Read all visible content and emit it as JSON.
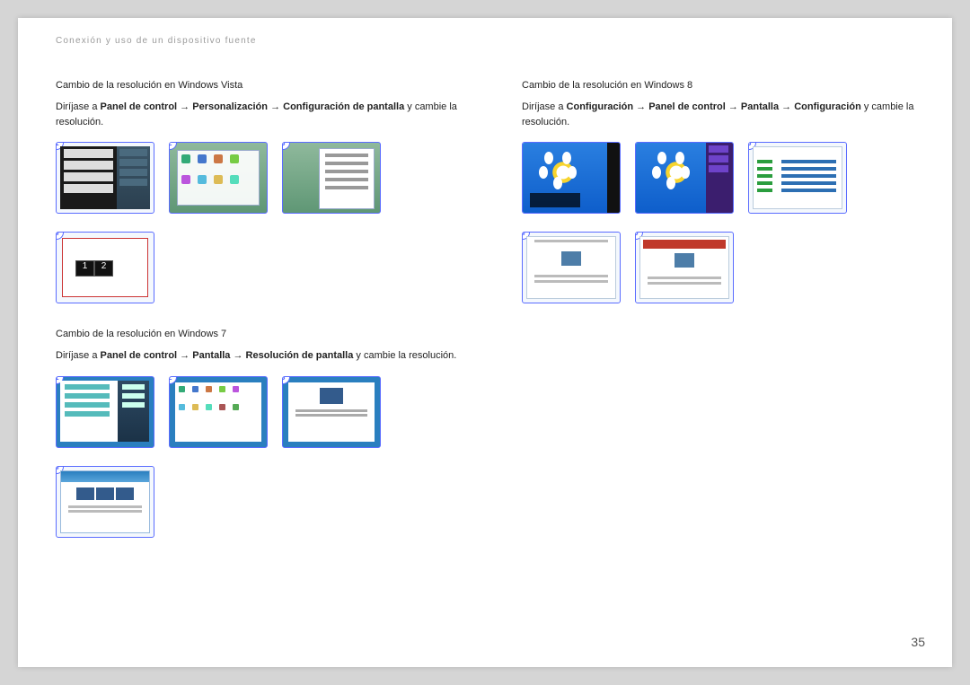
{
  "chapter": "Conexión y uso de un dispositivo fuente",
  "page_number": "35",
  "left": {
    "vista": {
      "title": "Cambio de la resolución en Windows Vista",
      "instr_pre": "Diríjase a ",
      "p1": "Panel de control",
      "p2": "Personalización",
      "p3": "Configuración de pantalla",
      "instr_post": " y cambie la resolución.",
      "steps": [
        "1",
        "2",
        "3",
        "4"
      ]
    },
    "w7": {
      "title": "Cambio de la resolución en Windows 7",
      "instr_pre": "Diríjase a ",
      "p1": "Panel de control",
      "p2": "Pantalla",
      "p3": "Resolución de pantalla",
      "instr_post": " y cambie la resolución.",
      "steps": [
        "1",
        "2",
        "3",
        "4"
      ]
    }
  },
  "right": {
    "w8": {
      "title": "Cambio de la resolución en Windows 8",
      "instr_pre": "Diríjase a ",
      "p1": "Configuración",
      "p2": "Panel de control",
      "p3": "Pantalla",
      "p4": "Configuración",
      "instr_post": " y cambie la resolución.",
      "steps": [
        "1",
        "2",
        "3",
        "4",
        "5"
      ]
    }
  }
}
